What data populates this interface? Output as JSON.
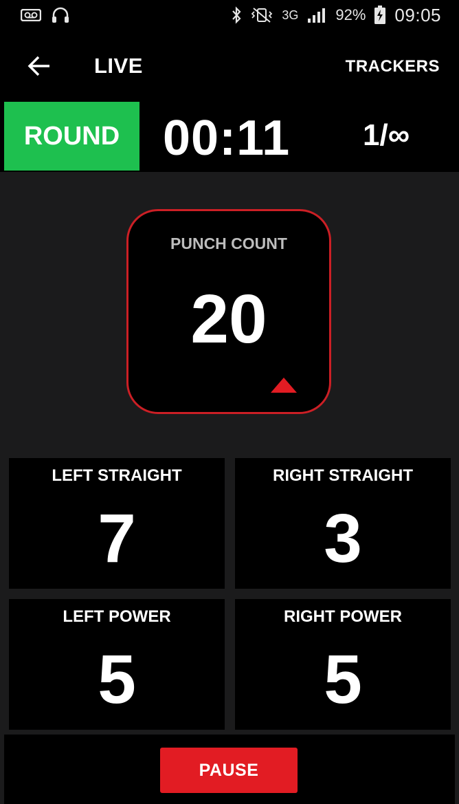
{
  "status_bar": {
    "icons_left": [
      "voicemail-icon",
      "headphones-icon"
    ],
    "icons_right": [
      "bluetooth-icon",
      "vibrate-mute-icon",
      "signal-icon",
      "battery-charging-icon"
    ],
    "network": "3G",
    "battery": "92%",
    "time": "09:05"
  },
  "appbar": {
    "back_icon": "arrow-left-icon",
    "title": "LIVE",
    "trackers_label": "TRACKERS"
  },
  "round": {
    "label": "ROUND",
    "timer": "00:11",
    "counter": "1/∞",
    "badge_color": "#1ec04f"
  },
  "punch_count": {
    "label": "PUNCH COUNT",
    "value": "20",
    "trend_icon": "triangle-up-icon",
    "border_color": "#cc1f25"
  },
  "stats": [
    {
      "label": "LEFT STRAIGHT",
      "value": "7"
    },
    {
      "label": "RIGHT STRAIGHT",
      "value": "3"
    },
    {
      "label": "LEFT POWER",
      "value": "5"
    },
    {
      "label": "RIGHT POWER",
      "value": "5"
    }
  ],
  "bottom": {
    "pause_label": "PAUSE",
    "pause_color": "#e21c23"
  }
}
